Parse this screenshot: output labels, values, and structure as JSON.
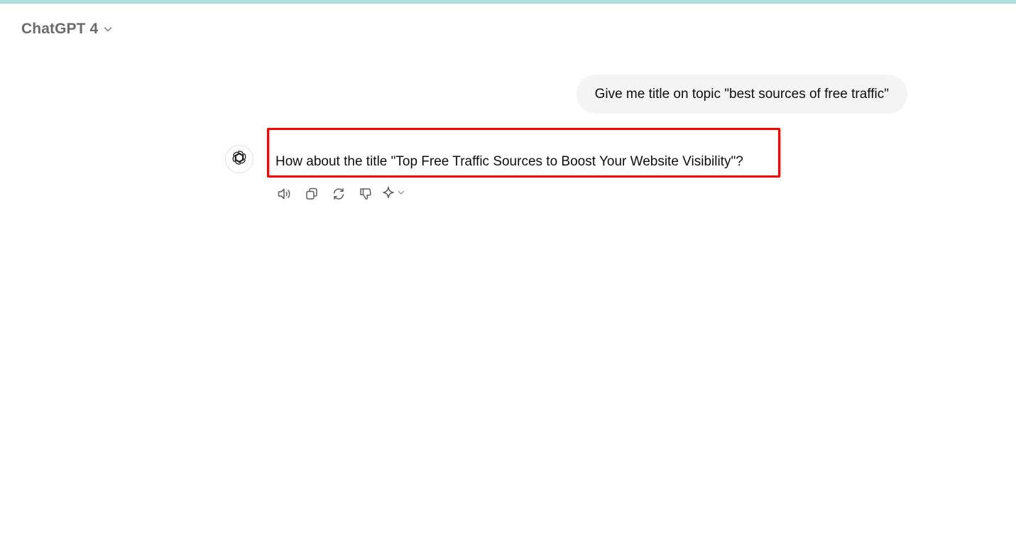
{
  "header": {
    "model_name": "ChatGPT 4",
    "model_chevron_icon": "chevron-down-icon"
  },
  "conversation": {
    "user_message": "Give me title on topic \"best sources of free traffic\"",
    "assistant_avatar_icon": "openai-logo-icon",
    "assistant_message": "How about the title \"Top Free Traffic Sources to Boost Your Website Visibility\"?",
    "actions": [
      {
        "name": "read-aloud",
        "icon": "speaker-icon"
      },
      {
        "name": "copy",
        "icon": "copy-icon"
      },
      {
        "name": "regenerate",
        "icon": "refresh-icon"
      },
      {
        "name": "bad-response",
        "icon": "thumbs-down-icon"
      },
      {
        "name": "change-model",
        "icon": "sparkle-icon"
      }
    ]
  },
  "colors": {
    "top_strip": "#b2e0df",
    "highlight_border": "#ff0000",
    "user_bubble_bg": "#f4f4f4",
    "muted_text": "#6b6b6b"
  }
}
